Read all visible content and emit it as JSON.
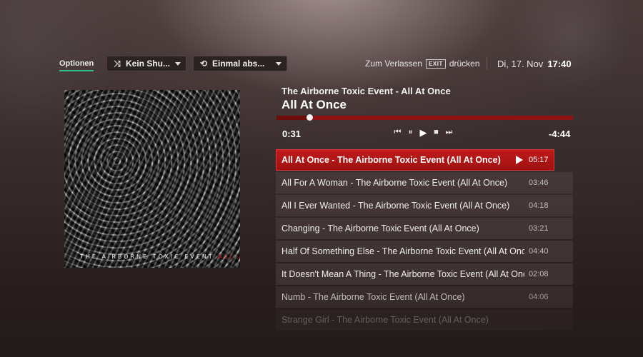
{
  "header": {
    "options_tab": "Optionen",
    "shuffle": {
      "label": "Kein Shu...",
      "icon": "shuffle-icon"
    },
    "repeat": {
      "label": "Einmal abs...",
      "icon": "repeat-icon"
    },
    "exit_hint_prefix": "Zum Verlassen",
    "exit_key": "EXIT",
    "exit_hint_suffix": "drücken",
    "date": "Di, 17. Nov",
    "time": "17:40"
  },
  "album": {
    "cover_text_artist": "THE AIRBORNE TOXIC EVENT",
    "cover_text_album": "ALL AT ONCE"
  },
  "now_playing": {
    "artist_album": "The Airborne Toxic Event - All At Once",
    "title": "All At Once",
    "elapsed": "0:31",
    "remaining": "-4:44",
    "progress_fraction": 0.11
  },
  "controls": [
    "skip-back-icon",
    "pause-icon",
    "play-icon",
    "stop-icon",
    "skip-forward-icon"
  ],
  "tracks": [
    {
      "title": "All At Once - The Airborne Toxic Event (All At Once)",
      "duration": "05:17"
    },
    {
      "title": "All For A Woman - The Airborne Toxic Event (All At Once)",
      "duration": "03:46"
    },
    {
      "title": "All I Ever Wanted - The Airborne Toxic Event (All At Once)",
      "duration": "04:18"
    },
    {
      "title": "Changing - The Airborne Toxic Event (All At Once)",
      "duration": "03:21"
    },
    {
      "title": "Half Of Something Else - The Airborne Toxic Event (All At Once)",
      "duration": "04:40"
    },
    {
      "title": "It Doesn't Mean A Thing - The Airborne Toxic Event (All At Once)",
      "duration": "02:08"
    },
    {
      "title": "Numb - The Airborne Toxic Event (All At Once)",
      "duration": "04:06"
    },
    {
      "title": "Strange Girl - The Airborne Toxic Event (All At Once)",
      "duration": ""
    }
  ],
  "colors": {
    "accent": "#b81515",
    "tab_underline": "#2fbf8a"
  }
}
